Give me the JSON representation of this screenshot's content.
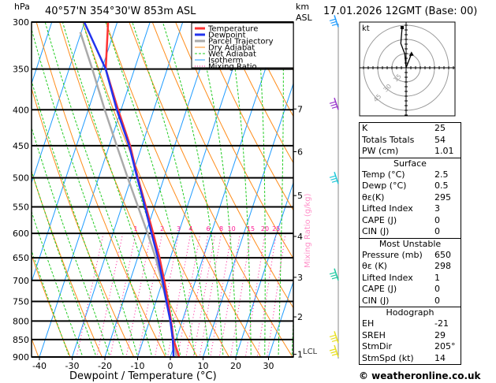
{
  "header": {
    "hpa_label": "hPa",
    "location": "40°57'N  354°30'W  853m  ASL",
    "km_label": "km",
    "asl_label": "ASL",
    "datetime": "17.01.2026  12GMT  (Base: 00)"
  },
  "legend": [
    {
      "label": "Temperature",
      "color": "#ff3333",
      "style": "solid"
    },
    {
      "label": "Dewpoint",
      "color": "#2233ee",
      "style": "solid"
    },
    {
      "label": "Parcel Trajectory",
      "color": "#aaaaaa",
      "style": "solid"
    },
    {
      "label": "Dry Adiabat",
      "color": "#ff8c1a",
      "style": "solid"
    },
    {
      "label": "Wet Adiabat",
      "color": "#22cc22",
      "style": "dashed"
    },
    {
      "label": "Isotherm",
      "color": "#1e9bff",
      "style": "solid"
    },
    {
      "label": "Mixing Ratio",
      "color": "#ff1493",
      "style": "dotted"
    }
  ],
  "chart_data": {
    "type": "skew-t",
    "xlabel": "Dewpoint / Temperature (°C)",
    "ylabel": "hPa",
    "xlim": [
      -42,
      38
    ],
    "ylim": [
      900,
      300
    ],
    "pressure_ticks": [
      300,
      350,
      400,
      450,
      500,
      550,
      600,
      650,
      700,
      750,
      800,
      850,
      900
    ],
    "temperature_ticks": [
      -40,
      -30,
      -20,
      -10,
      0,
      10,
      20,
      30
    ],
    "series": [
      {
        "name": "Temperature",
        "points": [
          [
            300,
            -52.8
          ],
          [
            350,
            -48.8
          ],
          [
            400,
            -40.9
          ],
          [
            450,
            -33.6
          ],
          [
            500,
            -28.0
          ],
          [
            550,
            -22.6
          ],
          [
            600,
            -17.7
          ],
          [
            650,
            -13.3
          ],
          [
            700,
            -9.6
          ],
          [
            750,
            -6.3
          ],
          [
            800,
            -3.4
          ],
          [
            850,
            -0.8
          ],
          [
            900,
            2.7
          ]
        ]
      },
      {
        "name": "Dewpoint",
        "points": [
          [
            300,
            -60.1
          ],
          [
            350,
            -48.8
          ],
          [
            400,
            -41.3
          ],
          [
            450,
            -33.9
          ],
          [
            500,
            -28.2
          ],
          [
            550,
            -22.9
          ],
          [
            600,
            -18.2
          ],
          [
            650,
            -13.8
          ],
          [
            700,
            -10.1
          ],
          [
            750,
            -6.8
          ],
          [
            800,
            -3.6
          ],
          [
            850,
            -1.0
          ],
          [
            900,
            1.0
          ]
        ]
      },
      {
        "name": "Parcel Trajectory",
        "points": [
          [
            310,
            -60.3
          ],
          [
            350,
            -52.9
          ],
          [
            400,
            -45.0
          ],
          [
            450,
            -37.7
          ],
          [
            500,
            -31.1
          ],
          [
            550,
            -25.0
          ],
          [
            600,
            -19.4
          ],
          [
            650,
            -14.5
          ],
          [
            700,
            -10.4
          ],
          [
            750,
            -6.8
          ],
          [
            800,
            -3.6
          ],
          [
            850,
            -0.8
          ],
          [
            900,
            1.9
          ]
        ]
      }
    ],
    "mixing_ratio_labels": [
      "1",
      "2",
      "3",
      "4",
      "6",
      "8",
      "10",
      "15",
      "20",
      "25"
    ],
    "mixing_ratio_axis_label": "Mixing Ratio (g/kg)",
    "km_ticks": [
      {
        "label": "1",
        "p": 892
      },
      {
        "label": "2",
        "p": 789
      },
      {
        "label": "3",
        "p": 693
      },
      {
        "label": "4",
        "p": 606
      },
      {
        "label": "5",
        "p": 530
      },
      {
        "label": "6",
        "p": 459
      },
      {
        "label": "7",
        "p": 399
      }
    ],
    "lcl": {
      "label": "LCL",
      "p": 882
    }
  },
  "wind_barbs": [
    {
      "p": 305,
      "color": "#1e9bff"
    },
    {
      "p": 400,
      "color": "#9933cc"
    },
    {
      "p": 510,
      "color": "#1ec8d8"
    },
    {
      "p": 700,
      "color": "#1ec8a0"
    },
    {
      "p": 860,
      "color": "#e8e020"
    },
    {
      "p": 900,
      "color": "#e8e020"
    }
  ],
  "hodograph": {
    "unit_label": "kt",
    "rings": [
      "15",
      "30",
      "45"
    ],
    "trace": [
      [
        0,
        0
      ],
      [
        -1.4,
        14.7
      ],
      [
        -5.6,
        25.8
      ],
      [
        -4.2,
        42.5
      ]
    ],
    "storm_vector": [
      [
        0,
        0
      ],
      [
        5.6,
        14.7
      ]
    ]
  },
  "indices": {
    "general": [
      {
        "label": "K",
        "value": "25"
      },
      {
        "label": "Totals Totals",
        "value": "54"
      },
      {
        "label": "PW (cm)",
        "value": "1.01"
      }
    ],
    "surface": {
      "title": "Surface",
      "rows": [
        {
          "label": "Temp (°C)",
          "value": "2.5"
        },
        {
          "label": "Dewp (°C)",
          "value": "0.5"
        },
        {
          "label": "θε(K)",
          "value": "295"
        },
        {
          "label": "Lifted Index",
          "value": "3"
        },
        {
          "label": "CAPE (J)",
          "value": "0"
        },
        {
          "label": "CIN (J)",
          "value": "0"
        }
      ]
    },
    "most_unstable": {
      "title": "Most Unstable",
      "rows": [
        {
          "label": "Pressure (mb)",
          "value": "650"
        },
        {
          "label": "θε (K)",
          "value": "298"
        },
        {
          "label": "Lifted Index",
          "value": "1"
        },
        {
          "label": "CAPE (J)",
          "value": "0"
        },
        {
          "label": "CIN (J)",
          "value": "0"
        }
      ]
    },
    "hodograph": {
      "title": "Hodograph",
      "rows": [
        {
          "label": "EH",
          "value": "-21"
        },
        {
          "label": "SREH",
          "value": "29"
        },
        {
          "label": "StmDir",
          "value": "205°"
        },
        {
          "label": "StmSpd (kt)",
          "value": "14"
        }
      ]
    }
  },
  "footer": {
    "copyright": "© weatheronline.co.uk"
  }
}
